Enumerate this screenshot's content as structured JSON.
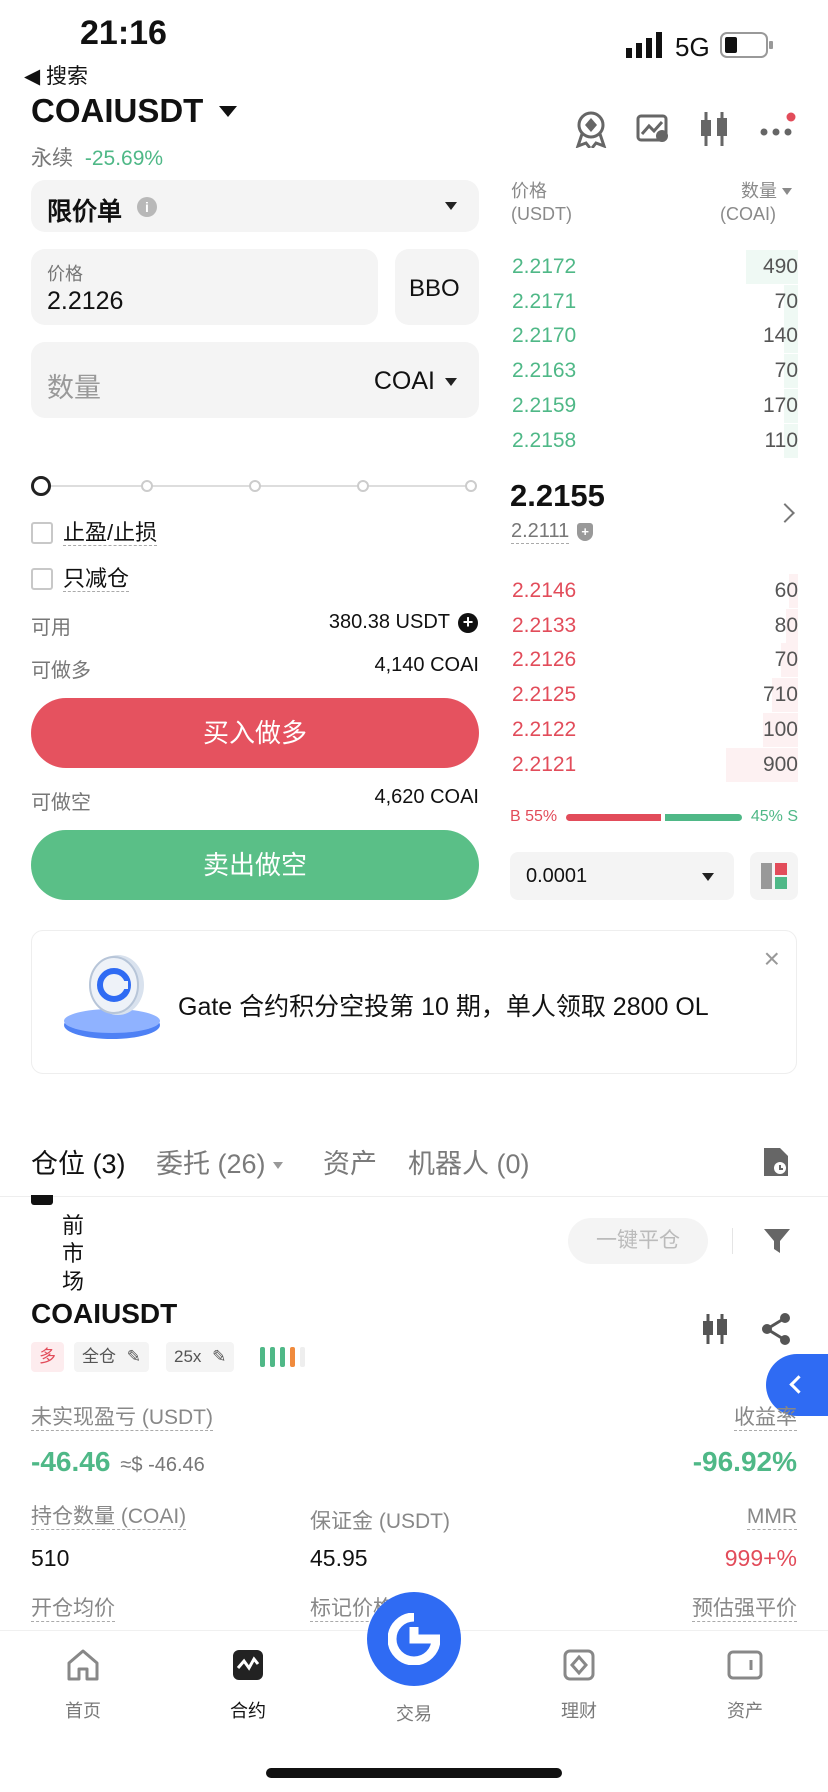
{
  "status_bar": {
    "time": "21:16",
    "network": "5G"
  },
  "back_nav": {
    "label": "◀ 搜索"
  },
  "header": {
    "symbol": "COAIUSDT",
    "type": "永续",
    "change": "-25.69%"
  },
  "order_form": {
    "order_type": "限价单",
    "price_label": "价格",
    "price_value": "2.2126",
    "bbo_label": "BBO",
    "qty_placeholder": "数量",
    "qty_unit": "COAI",
    "tp_sl_label": "止盈/止损",
    "reduce_only_label": "只减仓",
    "available_label": "可用",
    "available_value": "380.38 USDT",
    "can_long_label": "可做多",
    "can_long_value": "4,140 COAI",
    "buy_button": "买入做多",
    "can_short_label": "可做空",
    "can_short_value": "4,620 COAI",
    "sell_button": "卖出做空"
  },
  "order_book": {
    "price_header": "价格",
    "price_unit": "(USDT)",
    "qty_header": "数量",
    "qty_unit": "(COAI)",
    "asks": [
      {
        "price": "2.2172",
        "qty": "490",
        "depth": 0.18
      },
      {
        "price": "2.2171",
        "qty": "70",
        "depth": 0.05
      },
      {
        "price": "2.2170",
        "qty": "140",
        "depth": 0.05
      },
      {
        "price": "2.2163",
        "qty": "70",
        "depth": 0.05
      },
      {
        "price": "2.2159",
        "qty": "170",
        "depth": 0.05
      },
      {
        "price": "2.2158",
        "qty": "110",
        "depth": 0.05
      }
    ],
    "last_price": "2.2155",
    "mark_price": "2.2111",
    "bids": [
      {
        "price": "2.2146",
        "qty": "60",
        "depth": 0.03
      },
      {
        "price": "2.2133",
        "qty": "80",
        "depth": 0.04
      },
      {
        "price": "2.2126",
        "qty": "70",
        "depth": 0.06
      },
      {
        "price": "2.2125",
        "qty": "710",
        "depth": 0.09
      },
      {
        "price": "2.2122",
        "qty": "100",
        "depth": 0.12
      },
      {
        "price": "2.2121",
        "qty": "900",
        "depth": 0.25
      }
    ],
    "buy_ratio_label": "B 55%",
    "sell_ratio_label": "45% S",
    "buy_ratio": 0.55,
    "precision": "0.0001"
  },
  "banner": {
    "text": "Gate 合约积分空投第 10 期，单人领取 2800 OL"
  },
  "tabs": {
    "positions": "仓位",
    "positions_count": "(3)",
    "orders": "委托",
    "orders_count": "(26)",
    "assets": "资产",
    "bots": "机器人 (0)"
  },
  "filter": {
    "current_market": "前市场",
    "close_all": "一键平仓"
  },
  "position": {
    "symbol": "COAIUSDT",
    "side": "多",
    "margin_mode": "全仓",
    "leverage": "25x",
    "upnl_label": "未实现盈亏 (USDT)",
    "upnl_value": "-46.46",
    "upnl_usd": "≈$ -46.46",
    "roi_label": "收益率",
    "roi_value": "-96.92%",
    "size_label": "持仓数量 (COAI)",
    "size_value": "510",
    "margin_label": "保证金 (USDT)",
    "margin_value": "45.95",
    "mmr_label": "MMR",
    "mmr_value": "999+%",
    "entry_label": "开仓均价",
    "mark_label": "标记价格",
    "liq_label": "预估强平价"
  },
  "bottom_nav": {
    "home": "首页",
    "futures": "合约",
    "trade": "交易",
    "finance": "理财",
    "assets": "资产"
  },
  "colors": {
    "green": "#4fb887",
    "red": "#e24c5a",
    "blue": "#2f6bf3"
  }
}
